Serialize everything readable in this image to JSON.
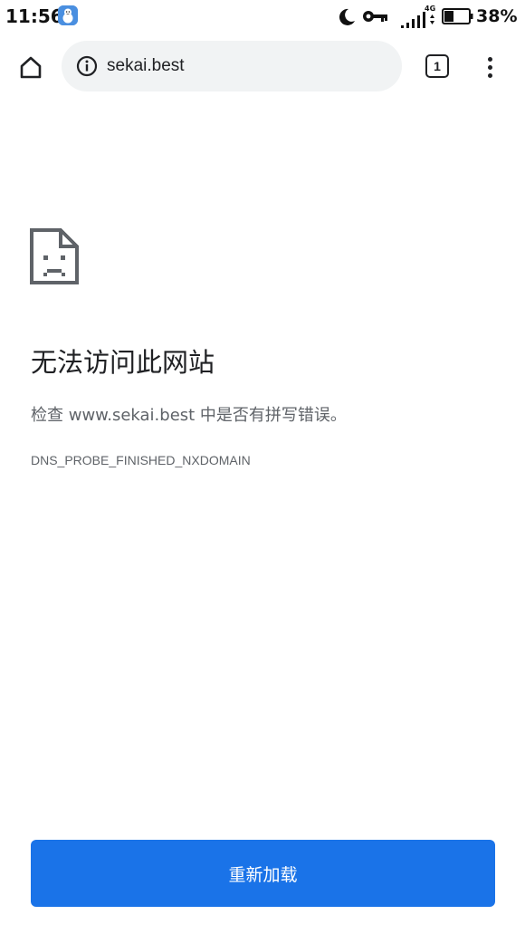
{
  "status_bar": {
    "time": "11:56",
    "app_icon": "snowman-app-icon",
    "network_type": "4G",
    "battery_percent": "38%",
    "battery_level": 0.38
  },
  "toolbar": {
    "url": "sekai.best",
    "tab_count": "1",
    "icons": {
      "home": "home-icon",
      "info": "info-icon",
      "menu": "more-vert-icon"
    }
  },
  "error_page": {
    "icon": "sad-document-icon",
    "title": "无法访问此网站",
    "message": "检查 www.sekai.best 中是否有拼写错误。",
    "code": "DNS_PROBE_FINISHED_NXDOMAIN",
    "reload_label": "重新加载"
  },
  "colors": {
    "accent": "#1a73e8",
    "omnibox_bg": "#f1f3f4",
    "text_primary": "#202124",
    "text_secondary": "#5f6368"
  }
}
